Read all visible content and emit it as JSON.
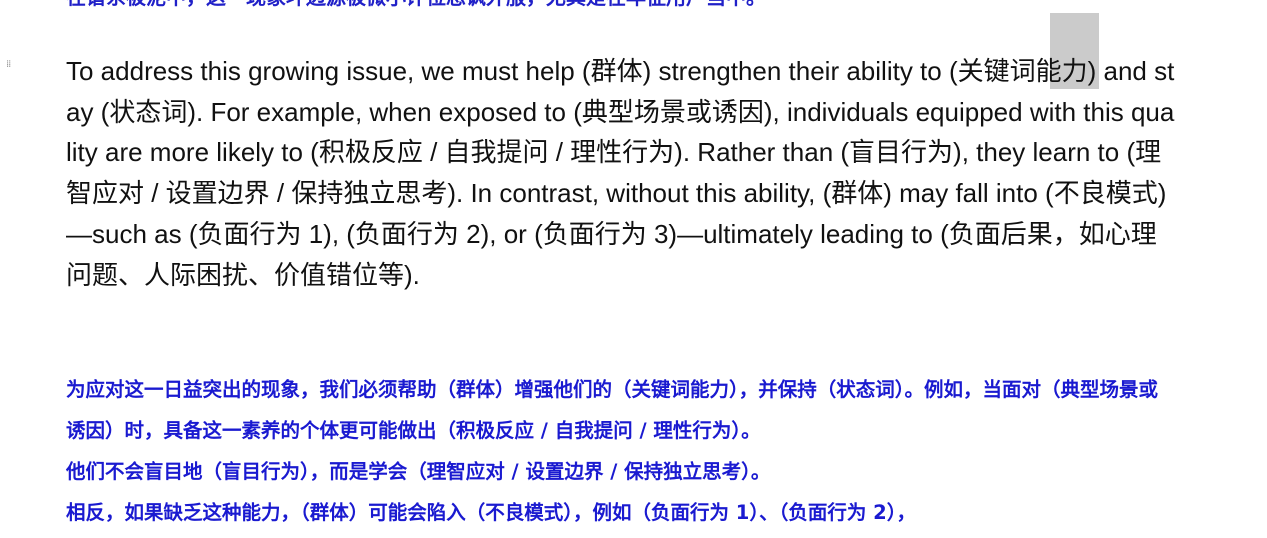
{
  "document": {
    "top_cut_line": "在谱系被泥中，这一现象坏边源被微小评位忽讽外服，尤其是在年征用户当中。",
    "english_paragraph": "To address this growing issue, we must help (群体) strengthen their ability to (关键词能力) and stay (状态词). For example, when exposed to (典型场景或诱因), individuals equipped with this quality are more likely to (积极反应 / 自我提问 / 理性行为). Rather than (盲目行为), they learn to (理智应对 / 设置边界 / 保持独立思考). In contrast, without this ability, (群体) may fall into (不良模式)—such as (负面行为 1), (负面行为 2), or (负面行为 3)—ultimately leading to (负面后果，如心理问题、人际困扰、价值错位等).",
    "chinese_paragraph_1": "为应对这一日益突出的现象，我们必须帮助（群体）增强他们的（关键词能力），并保持（状态词）。例如，当面对（典型场景或诱因）时，具备这一素养的个体更可能做出（积极反应 / 自我提问 / 理性行为）。",
    "chinese_paragraph_2": "他们不会盲目地（盲目行为），而是学会（理智应对 / 设置边界 / 保持独立思考）。",
    "chinese_paragraph_3": "相反，如果缺乏这种能力，（群体）可能会陷入（不良模式），例如（负面行为 1）、（负面行为 2），"
  },
  "colors": {
    "english_text": "#111111",
    "chinese_text": "#1a1ad0",
    "selection": "#8c8c8c"
  },
  "icons": {
    "drag_handle": "drag-handle-icon"
  }
}
